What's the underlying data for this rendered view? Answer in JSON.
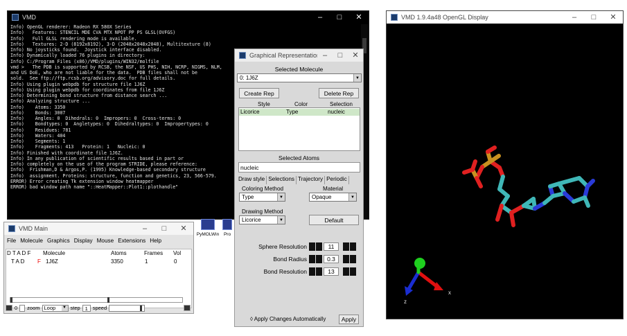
{
  "console": {
    "title": "VMD",
    "lines": [
      "Info) OpenGL renderer: Radeon RX 580X Series",
      "Info)   Features: STENCIL MDE CVA MTX NPOT PP PS GLSL(OVFGS)",
      "Info)   Full GLSL rendering mode is available.",
      "Info)   Textures: 2-D (8192x8192), 3-D (2048x2048x2048), Multitexture (8)",
      "Info) No joysticks found.  Joystick interface disabled.",
      "Info) Dynamically loaded 76 plugins in directory:",
      "Info) C:/Program Files (x86)/VMD/plugins/WIN32/molfile",
      "vmd >   The PDB is supported by RCSB, the NSF, US PHS, NIH, NCRP, NIGMS, NLM,",
      "and US DoE, who are not liable for the data.  PDB files shall not be",
      "sold.  See ftp://ftp.rcsb.org/advisory.doc for full details.",
      "Info) Using plugin webpdb for structure file 1J6Z",
      "Info) Using plugin webpdb for coordinates from file 1J6Z",
      "Info) Determining bond structure from distance search ...",
      "Info) Analyzing structure ...",
      "Info)    Atoms: 3350",
      "Info)    Bonds: 3007",
      "Info)    Angles: 0  Dihedrals: 0  Impropers: 0  Cross-terms: 0",
      "Info)    Bondtypes: 0  Angletypes: 0  Dihedraltypes: 0  Impropertypes: 0",
      "Info)    Residues: 781",
      "Info)    Waters: 404",
      "Info)    Segments: 1",
      "Info)    Fragments: 413   Protein: 1   Nucleic: 0",
      "Info) Finished with coordinate file 1J6Z.",
      "Info) In any publication of scientific results based in part or",
      "Info) completely on the use of the program STRIDE, please reference:",
      "Info)  Frishman,D & Argos,P. (1995) Knowledge-based secondary structure",
      "Info)  assignment. Proteins: structure, function and genetics, 23, 566-579.",
      "ERROR) Error creating Tk extension window heatmapper",
      "ERROR) bad window path name \"::HeatMapper::Plot1::plothandle\""
    ]
  },
  "desktop_icons": [
    {
      "label": "PyMOLWin"
    },
    {
      "label": "Pro"
    }
  ],
  "vmd_main": {
    "title": "VMD Main",
    "menu": [
      "File",
      "Molecule",
      "Graphics",
      "Display",
      "Mouse",
      "Extensions",
      "Help"
    ],
    "columns": {
      "flags": "D  T  A  D  F",
      "molecule": "Molecule",
      "atoms": "Atoms",
      "frames": "Frames",
      "vol": "Vol"
    },
    "row": {
      "flags_pre": "T  A  D",
      "flag_f": "F",
      "molecule": "1J6Z",
      "atoms": "3350",
      "frames": "1",
      "vol": "0"
    },
    "anim": {
      "frame": "0",
      "zoom": "zoom",
      "mode": "Loop",
      "step_label": "step",
      "step": "1",
      "speed": "speed"
    }
  },
  "graph_reps": {
    "title": "Graphical Representations",
    "selected_molecule_label": "Selected Molecule",
    "selected_molecule": "0: 1J6Z",
    "create_rep": "Create Rep",
    "delete_rep": "Delete Rep",
    "table_headers": {
      "style": "Style",
      "color": "Color",
      "selection": "Selection"
    },
    "rep": {
      "style": "Licorice",
      "color": "Type",
      "selection": "nucleic"
    },
    "selected_atoms_label": "Selected Atoms",
    "selected_atoms": "nucleic",
    "tabs": [
      "Draw style",
      "Selections",
      "Trajectory",
      "Periodic"
    ],
    "coloring_method_label": "Coloring Method",
    "coloring_method": "Type",
    "material_label": "Material",
    "material": "Opaque",
    "drawing_method_label": "Drawing Method",
    "drawing_method": "Licorice",
    "default_button": "Default",
    "sphere_resolution_label": "Sphere Resolution",
    "sphere_resolution": "11",
    "bond_radius_label": "Bond Radius",
    "bond_radius": "0.3",
    "bond_resolution_label": "Bond Resolution",
    "bond_resolution": "13",
    "apply_auto_label": "Apply Changes Automatically",
    "apply_button": "Apply"
  },
  "gl_display": {
    "title": "VMD 1.9.4a48 OpenGL Display",
    "axis_x": "x",
    "axis_z": "z"
  },
  "colors": {
    "carbon": "#3fb7b7",
    "oxygen": "#e02020",
    "nitrogen": "#2a3bd8",
    "phosphorus": "#c89020",
    "axis_x": "#e01010",
    "axis_y": "#1fd01f",
    "axis_z": "#1a2dd0"
  }
}
